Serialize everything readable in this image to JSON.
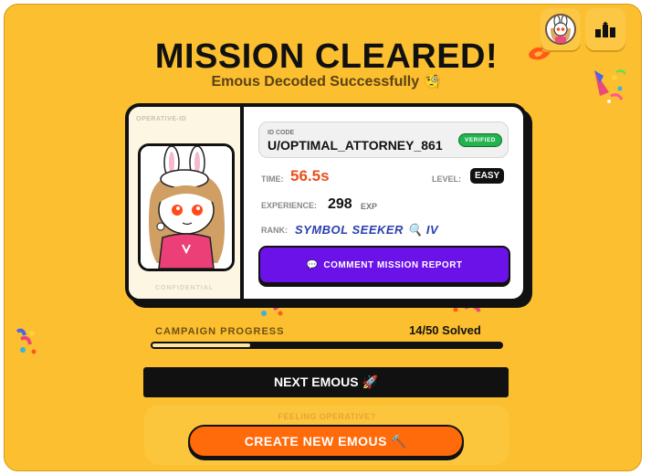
{
  "header": {
    "title": "MISSION CLEARED!",
    "subtitle": "Emous Decoded Successfully 🧐"
  },
  "topbar": {
    "profile_icon": "avatar-icon",
    "leaderboard_icon": "podium-icon"
  },
  "card": {
    "operative_label": "OPERATIVE-ID",
    "confidential_label": "CONFIDENTIAL",
    "id_label": "ID CODE",
    "id_value": "U/OPTIMAL_ATTORNEY_861",
    "verified": "VERIFIED",
    "time_label": "TIME:",
    "time_value": "56.5s",
    "level_label": "LEVEL:",
    "level_value": "EASY",
    "exp_label": "EXPERIENCE:",
    "exp_value": "298",
    "exp_unit": "EXP",
    "rank_label": "RANK:",
    "rank_value": "SYMBOL SEEKER 🔍 IV",
    "comment_icon": "💬",
    "comment_button": "COMMENT MISSION REPORT"
  },
  "progress": {
    "label": "CAMPAIGN PROGRESS",
    "value": "14/50 Solved",
    "solved": 14,
    "total": 50
  },
  "actions": {
    "next_button": "NEXT EMOUS 🚀",
    "feeling_label": "FEELING OPERATIVE?",
    "create_button": "CREATE NEW EMOUS 🔨"
  },
  "colors": {
    "background": "#fbbf2f",
    "accent_purple": "#6b12e8",
    "accent_orange": "#ff6b0a",
    "time_orange": "#e8501c",
    "rank_blue": "#2b3fae",
    "verified_green": "#23b34f"
  }
}
